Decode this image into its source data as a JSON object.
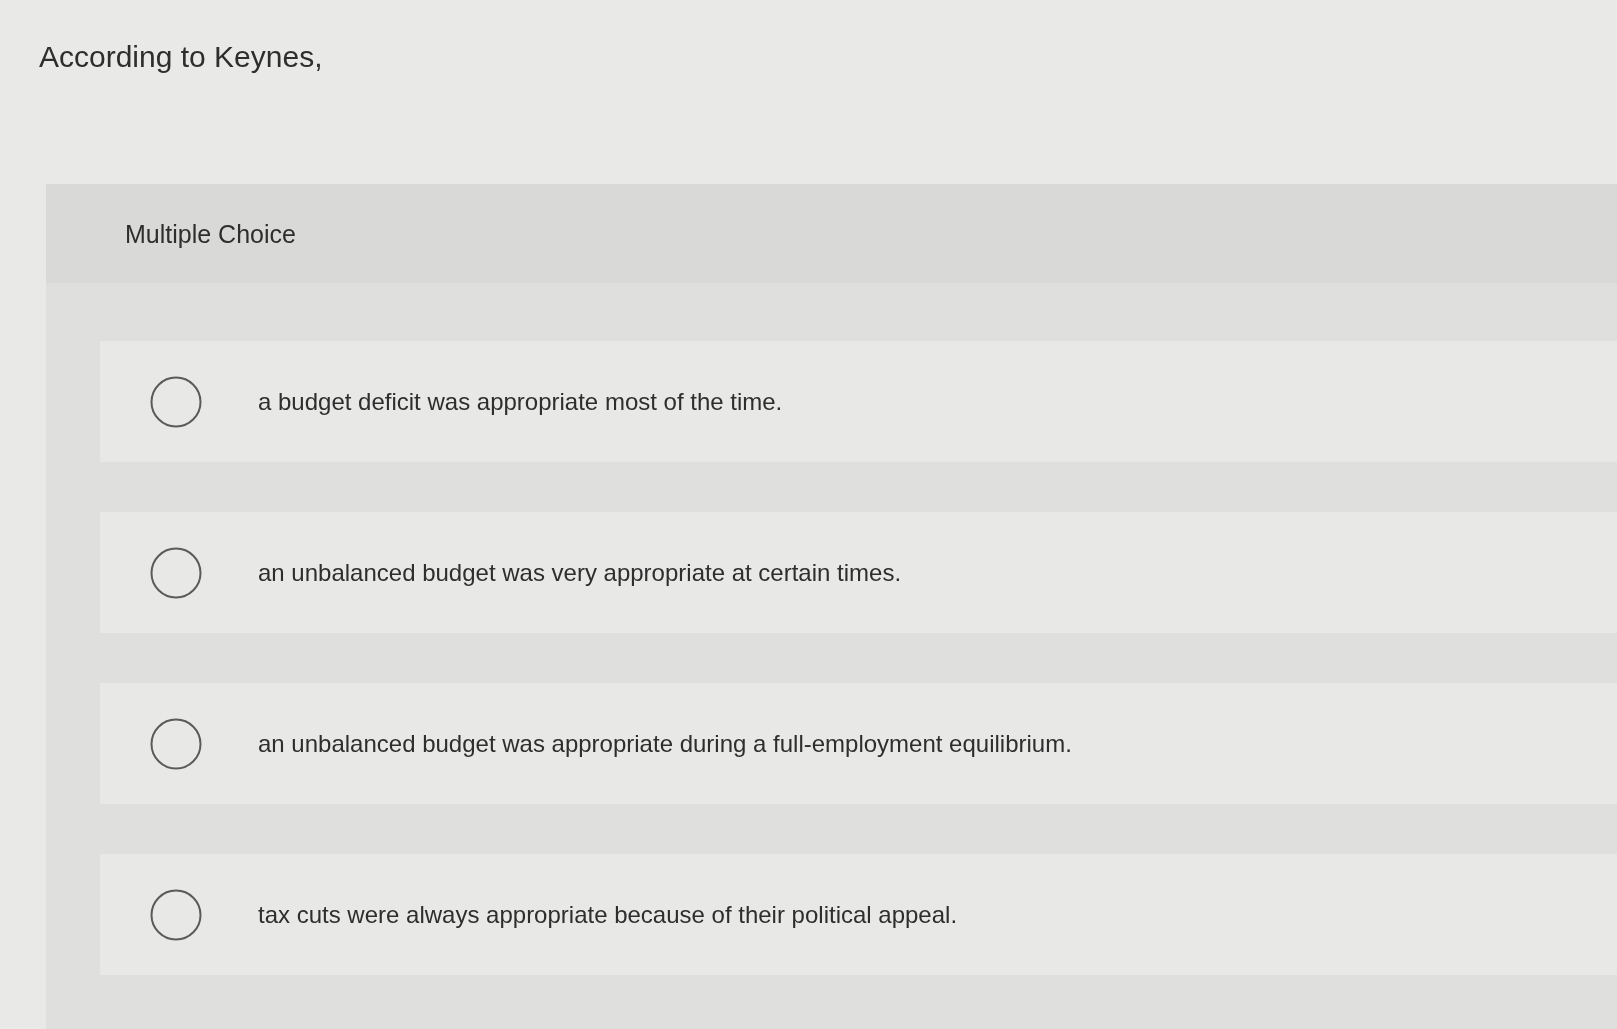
{
  "question": "According to Keynes,",
  "panel": {
    "title": "Multiple Choice"
  },
  "options": [
    {
      "label": "a budget deficit was appropriate most of the time.",
      "selected": false
    },
    {
      "label": "an unbalanced budget was very appropriate at certain times.",
      "selected": false
    },
    {
      "label": "an unbalanced budget was appropriate during a full-employment equilibrium.",
      "selected": false
    },
    {
      "label": "tax cuts were always appropriate because of their political appeal.",
      "selected": false
    }
  ]
}
